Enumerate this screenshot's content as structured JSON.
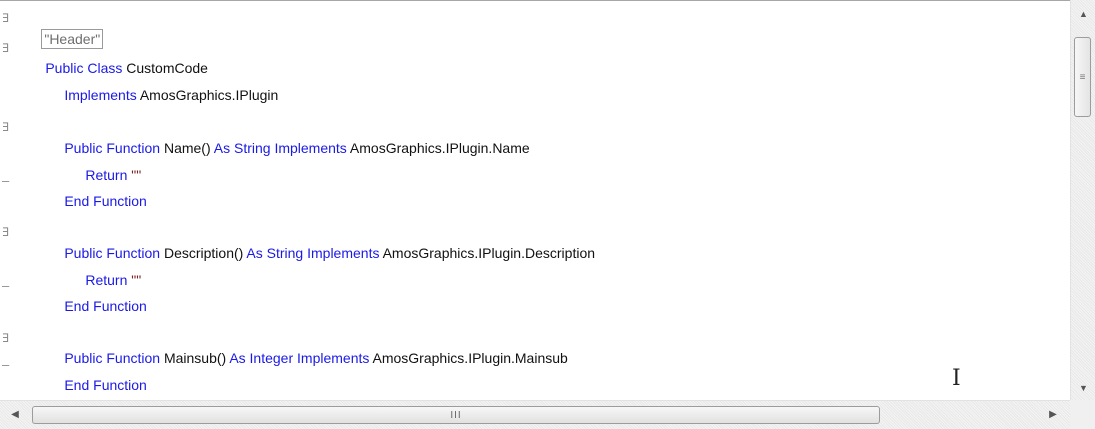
{
  "gutter": {
    "fold_open": "∃",
    "fold_end": "–"
  },
  "code_lines": [
    {
      "header": "\"Header\""
    },
    {
      "kw1": "Public Class ",
      "rest": "CustomCode"
    },
    {
      "kw1": "Implements ",
      "rest": "AmosGraphics.IPlugin"
    },
    {
      "kw1": "Public Function ",
      "rest": "Name() ",
      "kw2": "As String Implements ",
      "rest2": "AmosGraphics.IPlugin.Name"
    },
    {
      "kw1": "Return ",
      "str": "\"\""
    },
    {
      "kw1": "End Function"
    },
    {
      "kw1": "Public Function ",
      "rest": "Description() ",
      "kw2": "As String Implements ",
      "rest2": "AmosGraphics.IPlugin.Description"
    },
    {
      "kw1": "Return ",
      "str": "\"\""
    },
    {
      "kw1": "End Function"
    },
    {
      "kw1": "Public Function ",
      "rest": "Mainsub() ",
      "kw2": "As Integer Implements ",
      "rest2": "AmosGraphics.IPlugin.Mainsub"
    },
    {
      "kw1": "End Function"
    }
  ],
  "scrollbar": {
    "up_arrow": "▲",
    "down_arrow": "▼",
    "left_arrow": "◀",
    "right_arrow": "▶",
    "v_grip": "≡",
    "h_grip": "III"
  },
  "cursor_glyph": "I"
}
